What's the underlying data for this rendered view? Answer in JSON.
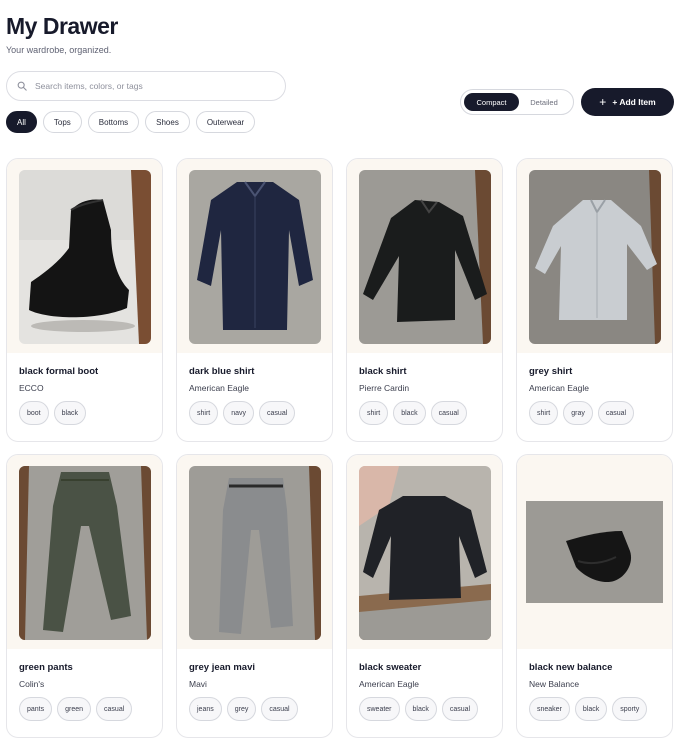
{
  "page": {
    "title": "My Drawer",
    "subtitle": "Your wardrobe, organized."
  },
  "search": {
    "placeholder": "Search items, colors, or tags",
    "value": ""
  },
  "filters": [
    "All",
    "Tops",
    "Bottoms",
    "Shoes",
    "Outerwear"
  ],
  "active_filter": "All",
  "view_toggle": {
    "compact_label": "Compact",
    "detailed_label": "Detailed",
    "selected": "Compact"
  },
  "add_button": {
    "label": "+ Add Item"
  },
  "items": [
    {
      "name": "black formal boot",
      "brand": "ECCO",
      "tags": [
        "boot",
        "black"
      ],
      "image": "boot"
    },
    {
      "name": "dark blue shirt",
      "brand": "American Eagle",
      "tags": [
        "shirt",
        "navy",
        "casual"
      ],
      "image": "navy-shirt"
    },
    {
      "name": "black shirt",
      "brand": "Pierre Cardin",
      "tags": [
        "shirt",
        "black",
        "casual"
      ],
      "image": "black-shirt"
    },
    {
      "name": "grey shirt",
      "brand": "American Eagle",
      "tags": [
        "shirt",
        "gray",
        "casual"
      ],
      "image": "grey-shirt"
    },
    {
      "name": "green pants",
      "brand": "Colin's",
      "tags": [
        "pants",
        "green",
        "casual"
      ],
      "image": "green-pants"
    },
    {
      "name": "grey jean mavi",
      "brand": "Mavi",
      "tags": [
        "jeans",
        "grey",
        "casual"
      ],
      "image": "grey-jeans"
    },
    {
      "name": "black sweater",
      "brand": "American Eagle",
      "tags": [
        "sweater",
        "black",
        "casual"
      ],
      "image": "black-sweater"
    },
    {
      "name": "black new balance",
      "brand": "New Balance",
      "tags": [
        "sneaker",
        "black",
        "sporty"
      ],
      "image": "sneaker"
    }
  ],
  "colors": {
    "primary": "#171a2b",
    "card_image_bg": "#fbf7f1",
    "border": "#e6e6ea"
  }
}
